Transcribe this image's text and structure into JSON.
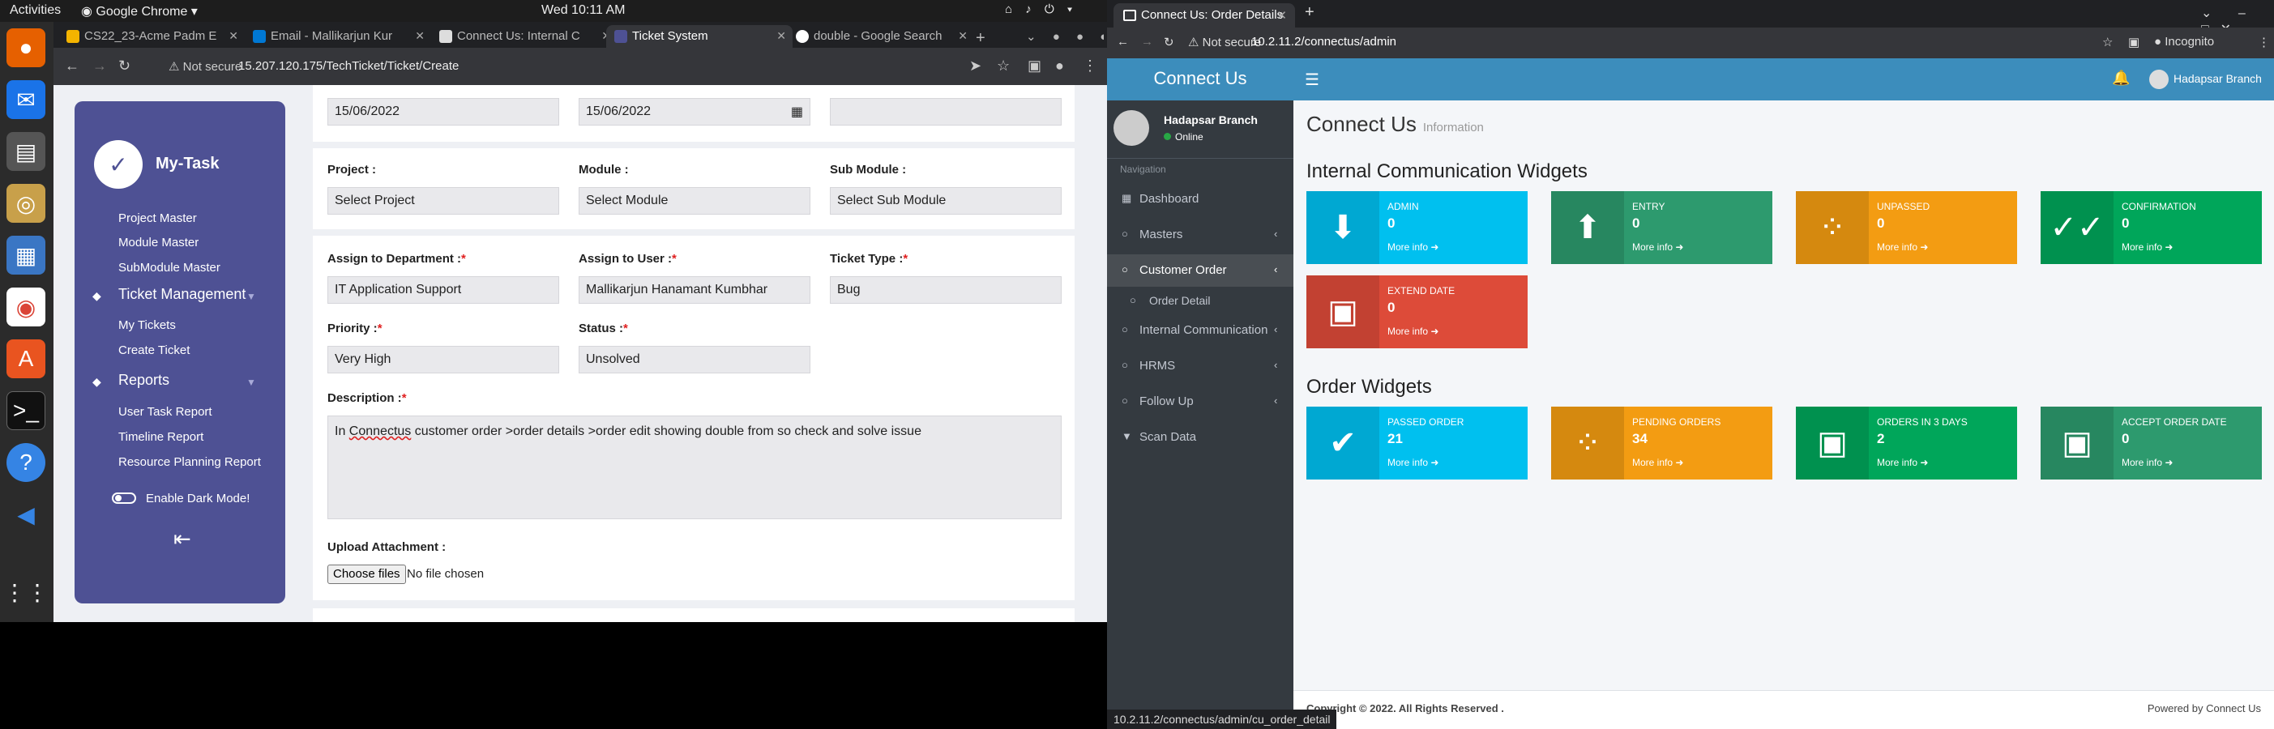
{
  "system": {
    "activities": "Activities",
    "app": "Google Chrome",
    "clock": "Wed 10:11 AM"
  },
  "left_browser": {
    "tabs": [
      {
        "title": "CS22_23-Acme Padm E"
      },
      {
        "title": "Email - Mallikarjun Kur"
      },
      {
        "title": "Connect Us: Internal C"
      },
      {
        "title": "Ticket System"
      },
      {
        "title": "double - Google Search"
      }
    ],
    "not_secure": "Not secure",
    "url": "15.207.120.175/TechTicket/Ticket/Create"
  },
  "ticket_app": {
    "brand": "My-Task",
    "nav": {
      "project_master": "Project Master",
      "module_master": "Module Master",
      "submodule_master": "SubModule Master",
      "ticket_management": "Ticket Management",
      "my_tickets": "My Tickets",
      "create_ticket": "Create Ticket",
      "reports": "Reports",
      "user_task_report": "User Task Report",
      "timeline_report": "Timeline Report",
      "resource_planning_report": "Resource Planning Report",
      "dark_mode": "Enable Dark Mode!"
    },
    "form": {
      "date1": "15/06/2022",
      "date2": "15/06/2022",
      "project_label": "Project :",
      "project_value": "Select Project",
      "module_label": "Module :",
      "module_value": "Select Module",
      "submodule_label": "Sub Module :",
      "submodule_value": "Select Sub Module",
      "dept_label": "Assign to Department :",
      "dept_value": "IT Application Support",
      "user_label": "Assign to User :",
      "user_value": "Mallikarjun Hanamant Kumbhar",
      "type_label": "Ticket Type :",
      "type_value": "Bug",
      "priority_label": "Priority :",
      "priority_value": "Very High",
      "status_label": "Status :",
      "status_value": "Unsolved",
      "desc_label": "Description :",
      "desc_pre": "In ",
      "desc_word": "Connectus",
      "desc_post": " customer order >order details >order edit showing double from so check and solve issue",
      "req": "*",
      "upload_label": "Upload Attachment :",
      "choose_files": "Choose files",
      "no_file": "No file chosen"
    }
  },
  "right_browser": {
    "tab_title": "Connect Us: Order Details",
    "incognito": "Incognito",
    "not_secure": "Not secure",
    "url": "10.2.11.2/connectus/admin",
    "status_url": "10.2.11.2/connectus/admin/cu_order_detail"
  },
  "connectus": {
    "brand": "Connect Us",
    "user": "Hadapsar Branch",
    "online": "Online",
    "nav_header": "Navigation",
    "nav": [
      "Dashboard",
      "Masters",
      "Customer Order",
      "Order Detail",
      "Internal Communication",
      "HRMS",
      "Follow Up",
      "Scan Data"
    ],
    "top_user": "Hadapsar Branch",
    "title": "Connect Us",
    "subtitle": "Information",
    "sec1": "Internal Communication Widgets",
    "sec2": "Order Widgets",
    "more": "More info",
    "widgets1": [
      {
        "label": "ADMIN",
        "value": "0",
        "color": "#00c0ef"
      },
      {
        "label": "ENTRY",
        "value": "0",
        "color": "#2d9a6e"
      },
      {
        "label": "UNPASSED",
        "value": "0",
        "color": "#f39c12"
      },
      {
        "label": "CONFIRMATION",
        "value": "0",
        "color": "#00a65a"
      },
      {
        "label": "EXTEND DATE",
        "value": "0",
        "color": "#dd4b39"
      }
    ],
    "widgets2": [
      {
        "label": "PASSED ORDER",
        "value": "21",
        "color": "#00c0ef"
      },
      {
        "label": "PENDING ORDERS",
        "value": "34",
        "color": "#f39c12"
      },
      {
        "label": "ORDERS IN 3 DAYS",
        "value": "2",
        "color": "#00a65a"
      },
      {
        "label": "ACCEPT ORDER DATE",
        "value": "0",
        "color": "#2d9a6e"
      }
    ],
    "footer_left": "Copyright © 2022. All Rights Reserved .",
    "footer_right": "Powered by Connect Us"
  }
}
